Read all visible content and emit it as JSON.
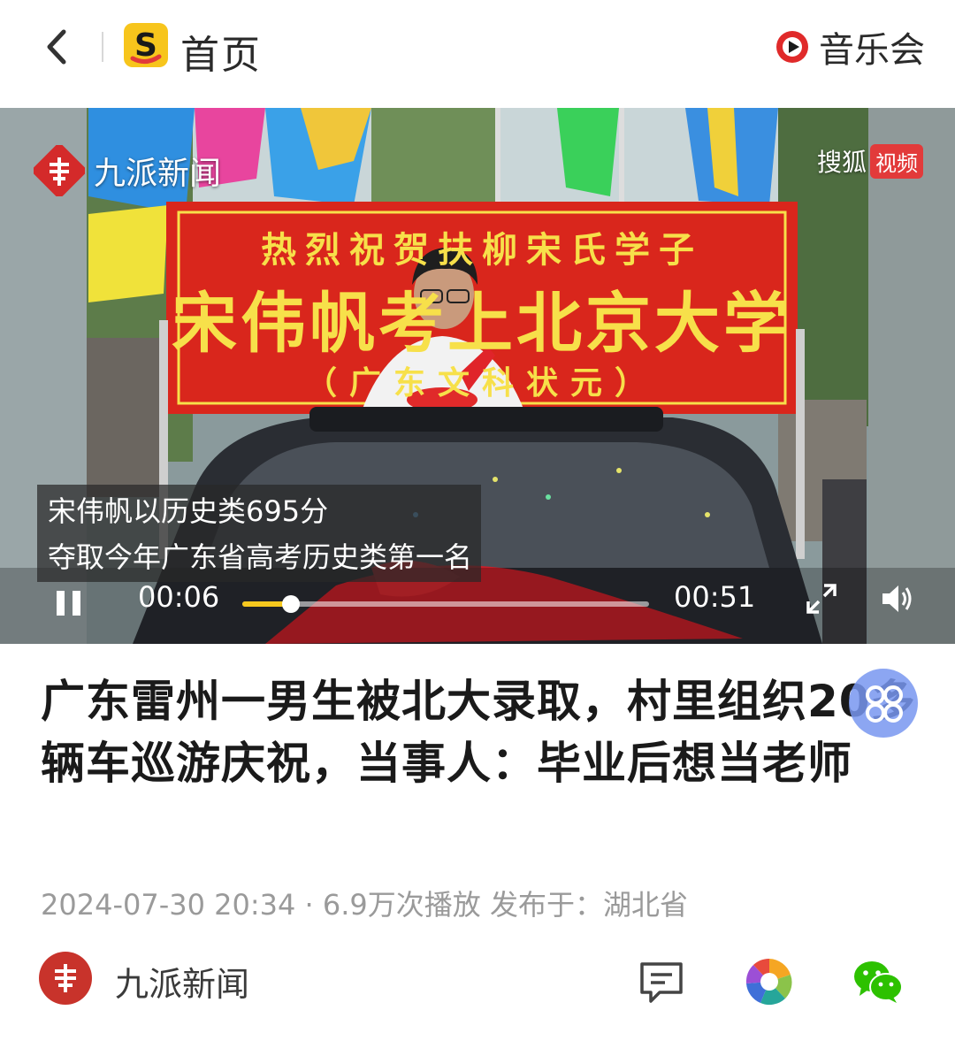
{
  "header": {
    "home_label": "首页",
    "concert_label": "音乐会"
  },
  "video": {
    "watermark_left": "九派新闻",
    "watermark_right": "搜狐",
    "watermark_right_badge": "视频",
    "banner": {
      "line1": "热烈祝贺扶柳宋氏学子",
      "line2": "宋伟帆考上北京大学",
      "line3": "（广东文科状元）"
    },
    "caption_line1": "宋伟帆以历史类695分",
    "caption_line2": "夺取今年广东省高考历史类第一名",
    "time_current": "00:06",
    "time_total": "00:51",
    "progress_fraction": 0.12,
    "progress_color": "#f6c81e"
  },
  "article": {
    "headline": "广东雷州一男生被北大录取，村里组织20多辆车巡游庆祝，当事人：毕业后想当老师",
    "datetime": "2024-07-30 20:34",
    "separator": "·",
    "play_count": "6.9万次播放",
    "published_from": "发布于：湖北省"
  },
  "source": {
    "name": "九派新闻"
  },
  "icons": [
    "back-arrow-icon",
    "sohu-logo-icon",
    "concert-play-icon",
    "pause-icon",
    "fullscreen-icon",
    "volume-icon",
    "comment-icon",
    "moments-icon",
    "wechat-icon"
  ],
  "colors": {
    "banner_red": "#d9261c",
    "banner_text": "#f7e04a",
    "accent_red": "#c8332b"
  }
}
